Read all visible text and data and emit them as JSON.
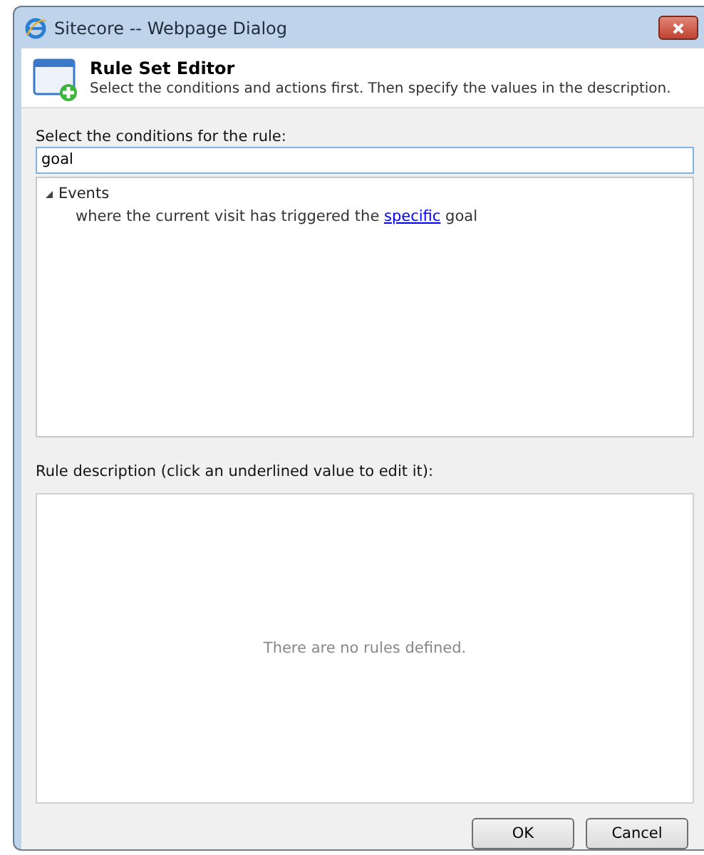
{
  "window": {
    "title": "Sitecore -- Webpage Dialog"
  },
  "header": {
    "title": "Rule Set Editor",
    "subtitle": "Select the conditions and actions first. Then specify the values in the description."
  },
  "conditions": {
    "label": "Select the conditions for the rule:",
    "search": {
      "value": "goal"
    },
    "tree": [
      {
        "label": "Events",
        "expanded": true,
        "children": [
          {
            "before": "where the current visit has triggered the ",
            "link": "specific",
            "after": " goal"
          }
        ]
      }
    ]
  },
  "description": {
    "label": "Rule description (click an underlined value to edit it):",
    "empty_text": "There are no rules defined."
  },
  "buttons": [
    "OK",
    "Cancel"
  ]
}
